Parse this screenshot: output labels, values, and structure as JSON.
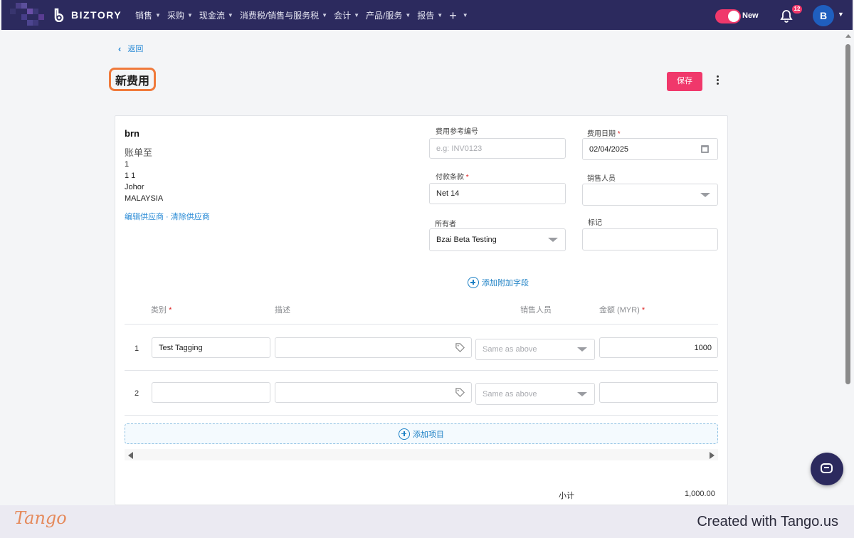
{
  "nav": {
    "brand": "BIZTORY",
    "menu": [
      "销售",
      "采购",
      "现金流",
      "消费税/销售与服务税",
      "会计",
      "产品/服务",
      "报告"
    ],
    "plus": "+",
    "toggle_label": "New",
    "notification_count": "12",
    "avatar_letter": "B"
  },
  "header": {
    "back_label": "返回",
    "title": "新费用",
    "save_label": "保存"
  },
  "vendor": {
    "name": "brn",
    "bill_to_label": "账单至",
    "address_lines": [
      "1",
      "1 1",
      "Johor",
      "MALAYSIA"
    ],
    "edit_link": "编辑供应商",
    "separator": " · ",
    "clear_link": "清除供应商"
  },
  "form": {
    "ref_label": "费用参考编号",
    "ref_placeholder": "e.g: INV0123",
    "date_label": "费用日期",
    "date_value": "02/04/2025",
    "terms_label": "付款条款",
    "terms_value": "Net 14",
    "salesperson_label": "销售人员",
    "salesperson_value": "",
    "owner_label": "所有者",
    "owner_value": "Bzai Beta Testing",
    "tag_label": "标记",
    "tag_value": "",
    "add_field_label": "添加附加字段"
  },
  "table": {
    "headers": {
      "category": "类别",
      "description": "描述",
      "salesperson": "销售人员",
      "amount": "金额 (MYR)"
    },
    "rows": [
      {
        "num": "1",
        "category": "Test Tagging",
        "description": "",
        "salesperson": "Same as above",
        "amount": "1000"
      },
      {
        "num": "2",
        "category": "",
        "description": "",
        "salesperson": "Same as above",
        "amount": ""
      }
    ],
    "add_item_label": "添加项目"
  },
  "totals": {
    "subtotal_label": "小计",
    "subtotal_value": "1,000.00"
  },
  "footer": {
    "logo_text": "Tango",
    "created_text": "Created with Tango.us"
  },
  "colors": {
    "nav_bg": "#2c2a5e",
    "accent": "#f0386b",
    "link": "#2a8bd6",
    "highlight": "#f07a3b"
  }
}
